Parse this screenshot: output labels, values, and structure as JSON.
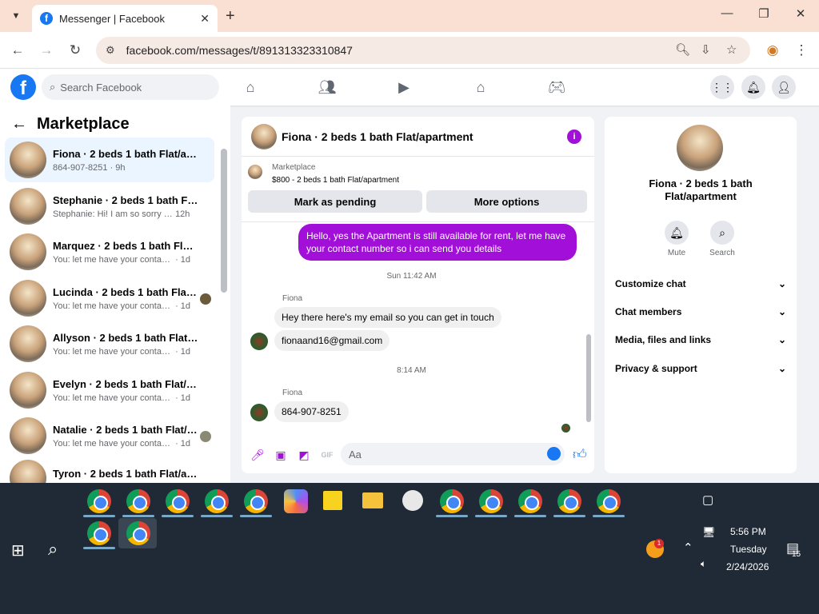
{
  "browser": {
    "tab_title": "Messenger | Facebook",
    "url": "facebook.com/messages/t/891313323310847"
  },
  "fb": {
    "search_placeholder": "Search Facebook"
  },
  "sidebar": {
    "title": "Marketplace",
    "conversations": [
      {
        "name": "Fiona · 2 beds 1 bath Flat/apart...",
        "preview": "864-907-8251",
        "time": "· 9h"
      },
      {
        "name": "Stephanie · 2 beds 1 bath Flat/a...",
        "preview": "Stephanie: Hi! I am so sorry for th...",
        "time": "12h"
      },
      {
        "name": "Marquez · 2 beds 1 bath Flat/ap...",
        "preview": "You: let me have your contact num...",
        "time": "· 1d"
      },
      {
        "name": "Lucinda · 2 beds 1 bath Flat/a...",
        "preview": "You: let me have your contact n...",
        "time": "· 1d"
      },
      {
        "name": "Allyson · 2 beds 1 bath Flat/apa...",
        "preview": "You: let me have your contact num...",
        "time": "· 1d"
      },
      {
        "name": "Evelyn · 2 beds 1 bath Flat/apart...",
        "preview": "You: let me have your contact num...",
        "time": "· 1d"
      },
      {
        "name": "Natalie · 2 beds 1 bath Flat/a...",
        "preview": "You: let me have your contact n...",
        "time": "· 1d"
      },
      {
        "name": "Tyron · 2 beds 1 bath Flat/apart...",
        "preview": "",
        "time": ""
      }
    ]
  },
  "chat": {
    "title": "Fiona · 2 beds 1 bath Flat/apartment",
    "marketplace_label": "Marketplace",
    "listing": "$800 - 2 beds 1 bath Flat/apartment",
    "mark_pending": "Mark as pending",
    "more_options": "More options",
    "my_message": "Hello, yes the Apartment is still available for rent, let me have your contact number so i can send you details",
    "time1": "Sun 11:42 AM",
    "sender1": "Fiona",
    "msg1": "Hey there here's my email so you can get in touch",
    "msg2": "fionaand16@gmail.com",
    "time2": "8:14 AM",
    "sender2": "Fiona",
    "msg3": "864-907-8251",
    "input_placeholder": "Aa"
  },
  "details": {
    "name": "Fiona · 2 beds 1 bath Flat/apartment",
    "mute": "Mute",
    "search": "Search",
    "items": [
      "Customize chat",
      "Chat members",
      "Media, files and links",
      "Privacy & support"
    ]
  },
  "taskbar": {
    "time": "5:56 PM",
    "day": "Tuesday",
    "date": "2/24/2026",
    "notif_count": "15",
    "app_badge": "1"
  },
  "colors": {
    "accent": "#a10fd8",
    "fb_blue": "#1877f2"
  }
}
